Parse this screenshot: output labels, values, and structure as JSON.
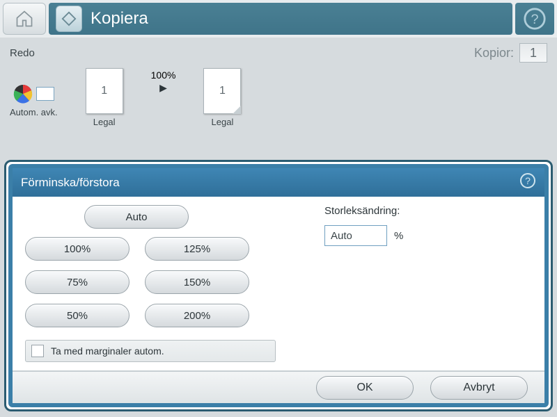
{
  "header": {
    "title": "Kopiera"
  },
  "status": {
    "state": "Redo",
    "copies_label": "Kopior:",
    "copies_value": "1"
  },
  "preview": {
    "mode_label": "Autom. avk.",
    "source_page_number": "1",
    "source_size": "Legal",
    "scale": "100%",
    "dest_page_number": "1",
    "dest_size": "Legal"
  },
  "dialog": {
    "title": "Förminska/förstora",
    "auto_label": "Auto",
    "presets": [
      "100%",
      "125%",
      "75%",
      "150%",
      "50%",
      "200%"
    ],
    "margin_checkbox": "Ta med marginaler autom.",
    "resize_label": "Storleksändring:",
    "resize_value": "Auto",
    "percent_symbol": "%",
    "ok": "OK",
    "cancel": "Avbryt"
  }
}
